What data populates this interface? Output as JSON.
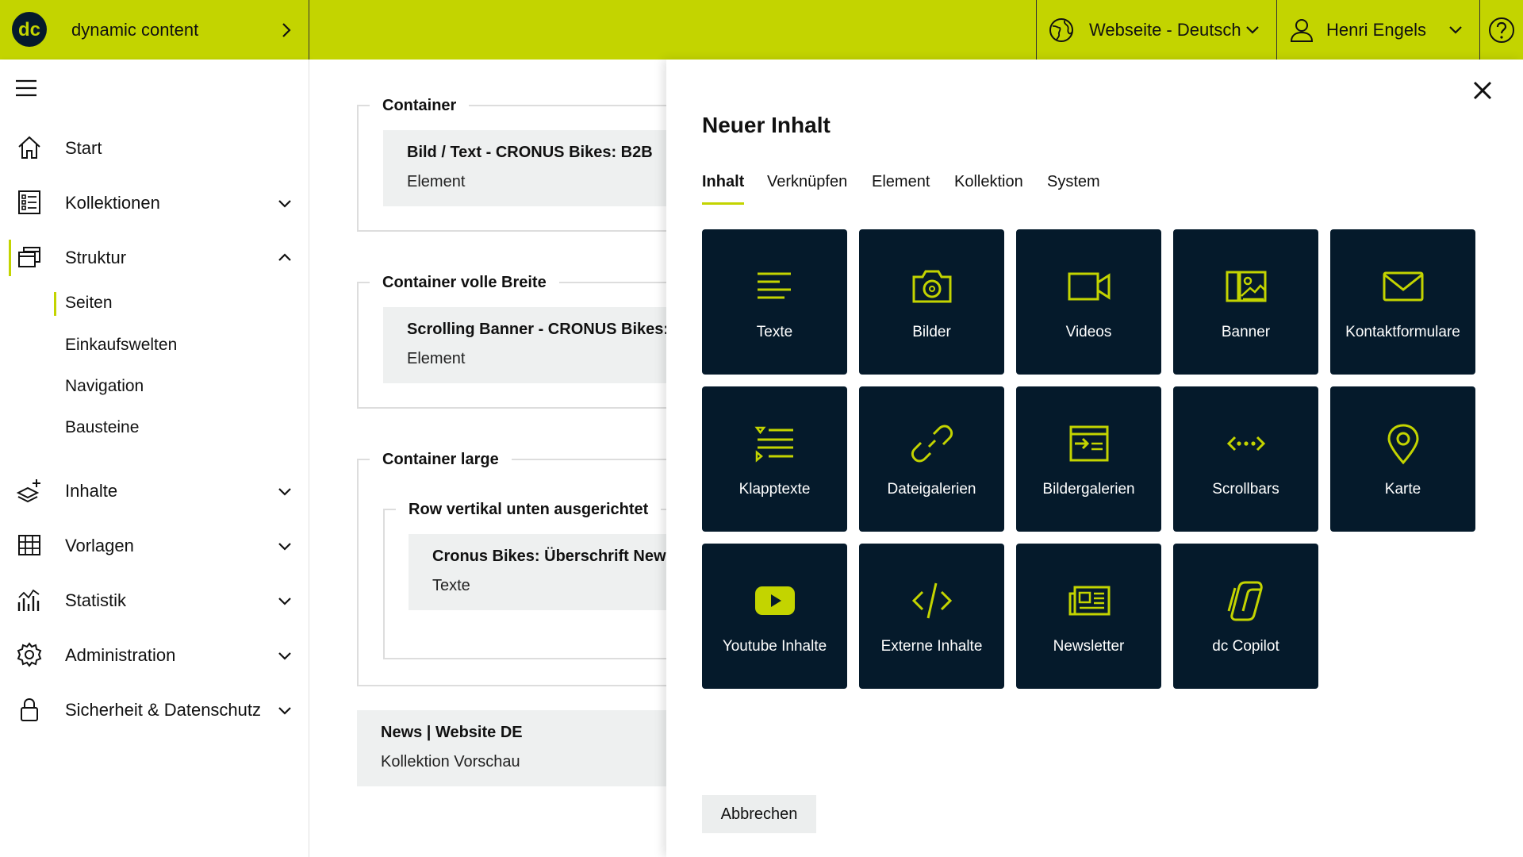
{
  "header": {
    "app_name": "dynamic content",
    "logo_text": "dc",
    "language": "Webseite - Deutsch",
    "user": "Henri Engels",
    "icons": {
      "language": "globe-icon",
      "user": "user-icon",
      "help": "help-icon"
    }
  },
  "colors": {
    "accent": "#c3d400",
    "tile_bg": "#051a2b",
    "card_bg": "#eef0f0"
  },
  "sidebar": {
    "items": [
      {
        "label": "Start",
        "icon": "home-icon"
      },
      {
        "label": "Kollektionen",
        "icon": "list-icon"
      },
      {
        "label": "Struktur",
        "icon": "windows-icon",
        "expanded": true
      },
      {
        "label": "Inhalte",
        "icon": "layers-plus-icon"
      },
      {
        "label": "Vorlagen",
        "icon": "grid-icon"
      },
      {
        "label": "Statistik",
        "icon": "chart-icon"
      },
      {
        "label": "Administration",
        "icon": "gear-icon"
      },
      {
        "label": "Sicherheit & Datenschutz",
        "icon": "lock-icon"
      }
    ],
    "subitems": [
      {
        "label": "Seiten",
        "active": true
      },
      {
        "label": "Einkaufswelten"
      },
      {
        "label": "Navigation"
      },
      {
        "label": "Bausteine"
      }
    ]
  },
  "main": {
    "containers": [
      {
        "title": "Container",
        "card_title": "Bild / Text - CRONUS Bikes: B2B",
        "card_sub": "Element"
      },
      {
        "title": "Container volle Breite",
        "card_title": "Scrolling Banner - CRONUS Bikes: Cl",
        "card_sub": "Element"
      },
      {
        "title": "Container large",
        "row_title": "Row vertikal unten ausgerichtet",
        "card_title": "Cronus Bikes: Überschrift Newsl",
        "card_sub": "Texte"
      }
    ],
    "collection_card": {
      "title": "News | Website DE",
      "sub": "Kollektion Vorschau"
    }
  },
  "panel": {
    "title": "Neuer Inhalt",
    "tabs": [
      {
        "label": "Inhalt",
        "active": true
      },
      {
        "label": "Verknüpfen"
      },
      {
        "label": "Element"
      },
      {
        "label": "Kollektion"
      },
      {
        "label": "System"
      }
    ],
    "tiles": [
      {
        "label": "Texte",
        "icon": "text-lines-icon"
      },
      {
        "label": "Bilder",
        "icon": "camera-icon"
      },
      {
        "label": "Videos",
        "icon": "video-camera-icon"
      },
      {
        "label": "Banner",
        "icon": "banner-image-icon"
      },
      {
        "label": "Kontaktformulare",
        "icon": "envelope-icon"
      },
      {
        "label": "Klapptexte",
        "icon": "accordion-list-icon"
      },
      {
        "label": "Dateigalerien",
        "icon": "link-icon"
      },
      {
        "label": "Bildergalerien",
        "icon": "gallery-window-icon"
      },
      {
        "label": "Scrollbars",
        "icon": "scroll-arrows-icon"
      },
      {
        "label": "Karte",
        "icon": "map-pin-icon"
      },
      {
        "label": "Youtube Inhalte",
        "icon": "youtube-icon"
      },
      {
        "label": "Externe Inhalte",
        "icon": "code-icon"
      },
      {
        "label": "Newsletter",
        "icon": "newspaper-icon"
      },
      {
        "label": "dc Copilot",
        "icon": "copilot-icon"
      }
    ],
    "cancel_label": "Abbrechen",
    "close_icon": "close-icon"
  }
}
